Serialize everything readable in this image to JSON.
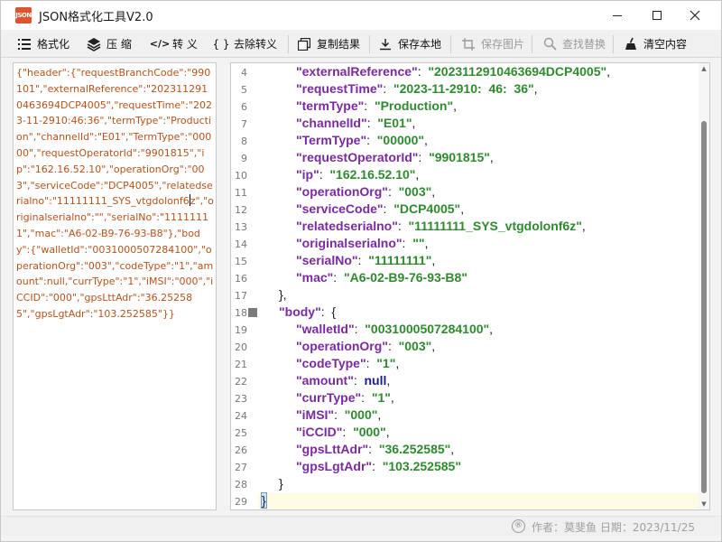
{
  "window": {
    "title": "JSON格式化工具V2.0",
    "icon_text": "JSON"
  },
  "toolbar": {
    "items": [
      {
        "label": "格式化",
        "icon": "list-icon",
        "enabled": true
      },
      {
        "label": "压 缩",
        "icon": "layers-icon",
        "enabled": true
      },
      {
        "label": "转 义",
        "icon": "code-icon",
        "enabled": true
      },
      {
        "label": "去除转义",
        "icon": "braces-icon",
        "enabled": true
      },
      {
        "label": "复制结果",
        "icon": "copy-icon",
        "enabled": true
      },
      {
        "label": "保存本地",
        "icon": "download-icon",
        "enabled": true
      },
      {
        "label": "保存图片",
        "icon": "crop-icon",
        "enabled": false
      },
      {
        "label": "查找替换",
        "icon": "search-replace-icon",
        "enabled": false
      },
      {
        "label": "清空内容",
        "icon": "broom-icon",
        "enabled": true
      }
    ]
  },
  "input": {
    "raw_before_caret": "{\"header\":{\"requestBranchCode\":\"990101\",\"externalReference\":\"2023112910463694DCP4005\",\"requestTime\":\"2023-11-2910:46:36\",\"termType\":\"Production\",\"channelId\":\"E01\",\"TermType\":\"00000\",\"requestOperatorId\":\"9901815\",\"ip\":\"162.16.52.10\",\"operationOrg\":\"003\",\"serviceCode\":\"DCP4005\",\"relatedserialno\":\"11111111_SYS_vtgdolonf6",
    "raw_after_caret": "z\",\"originalserialno\":\"\",\"serialNo\":\"11111111\",\"mac\":\"A6-02-B9-76-93-B8\"},\"body\":{\"walletId\":\"0031000507284100\",\"operationOrg\":\"003\",\"codeType\":\"1\",\"amount\":null,\"currType\":\"1\",\"iMSI\":\"000\",\"iCCID\":\"000\",\"gpsLttAdr\":\"36.252585\",\"gpsLgtAdr\":\"103.252585\"}}"
  },
  "editor": {
    "lines": [
      {
        "n": "4",
        "indent": 2,
        "key": "\"externalReference\"",
        "value": "\"2023112910463694DCP4005\"",
        "vtype": "str",
        "tail": ","
      },
      {
        "n": "5",
        "indent": 2,
        "key": "\"requestTime\"",
        "value": "\"2023-11-2910:  46:  36\"",
        "vtype": "str",
        "tail": ","
      },
      {
        "n": "6",
        "indent": 2,
        "key": "\"termType\"",
        "value": "\"Production\"",
        "vtype": "str",
        "tail": ","
      },
      {
        "n": "7",
        "indent": 2,
        "key": "\"channelId\"",
        "value": "\"E01\"",
        "vtype": "str",
        "tail": ","
      },
      {
        "n": "8",
        "indent": 2,
        "key": "\"TermType\"",
        "value": "\"00000\"",
        "vtype": "str",
        "tail": ","
      },
      {
        "n": "9",
        "indent": 2,
        "key": "\"requestOperatorId\"",
        "value": "\"9901815\"",
        "vtype": "str",
        "tail": ","
      },
      {
        "n": "10",
        "indent": 2,
        "key": "\"ip\"",
        "value": "\"162.16.52.10\"",
        "vtype": "str",
        "tail": ","
      },
      {
        "n": "11",
        "indent": 2,
        "key": "\"operationOrg\"",
        "value": "\"003\"",
        "vtype": "str",
        "tail": ","
      },
      {
        "n": "12",
        "indent": 2,
        "key": "\"serviceCode\"",
        "value": "\"DCP4005\"",
        "vtype": "str",
        "tail": ","
      },
      {
        "n": "13",
        "indent": 2,
        "key": "\"relatedserialno\"",
        "value": "\"11111111_SYS_vtgdolonf6z\"",
        "vtype": "str",
        "tail": ","
      },
      {
        "n": "14",
        "indent": 2,
        "key": "\"originalserialno\"",
        "value": "\"\"",
        "vtype": "str",
        "tail": ","
      },
      {
        "n": "15",
        "indent": 2,
        "key": "\"serialNo\"",
        "value": "\"11111111\"",
        "vtype": "str",
        "tail": ","
      },
      {
        "n": "16",
        "indent": 2,
        "key": "\"mac\"",
        "value": "\"A6-02-B9-76-93-B8\"",
        "vtype": "str",
        "tail": ""
      },
      {
        "n": "17",
        "indent": 1,
        "text": "},"
      },
      {
        "n": "18",
        "indent": 1,
        "key": "\"body\"",
        "value": "{",
        "vtype": "punc",
        "tail": "",
        "fold": true
      },
      {
        "n": "19",
        "indent": 2,
        "key": "\"walletId\"",
        "value": "\"0031000507284100\"",
        "vtype": "str",
        "tail": ","
      },
      {
        "n": "20",
        "indent": 2,
        "key": "\"operationOrg\"",
        "value": "\"003\"",
        "vtype": "str",
        "tail": ","
      },
      {
        "n": "21",
        "indent": 2,
        "key": "\"codeType\"",
        "value": "\"1\"",
        "vtype": "str",
        "tail": ","
      },
      {
        "n": "22",
        "indent": 2,
        "key": "\"amount\"",
        "value": "null",
        "vtype": "kw",
        "tail": ","
      },
      {
        "n": "23",
        "indent": 2,
        "key": "\"currType\"",
        "value": "\"1\"",
        "vtype": "str",
        "tail": ","
      },
      {
        "n": "24",
        "indent": 2,
        "key": "\"iMSI\"",
        "value": "\"000\"",
        "vtype": "str",
        "tail": ","
      },
      {
        "n": "25",
        "indent": 2,
        "key": "\"iCCID\"",
        "value": "\"000\"",
        "vtype": "str",
        "tail": ","
      },
      {
        "n": "26",
        "indent": 2,
        "key": "\"gpsLttAdr\"",
        "value": "\"36.252585\"",
        "vtype": "str",
        "tail": ","
      },
      {
        "n": "27",
        "indent": 2,
        "key": "\"gpsLgtAdr\"",
        "value": "\"103.252585\"",
        "vtype": "str",
        "tail": ""
      },
      {
        "n": "28",
        "indent": 1,
        "text": "}"
      },
      {
        "n": "29",
        "indent": 0,
        "text": "}",
        "current": true
      }
    ]
  },
  "status": {
    "reg_mark": "®",
    "text": "作者：莫斐鱼  日期：2023/11/25"
  },
  "colors": {
    "key": "#7a2aa0",
    "string": "#2f8a2f",
    "keyword": "#1a1aa6",
    "raw_text": "#b5521b"
  }
}
